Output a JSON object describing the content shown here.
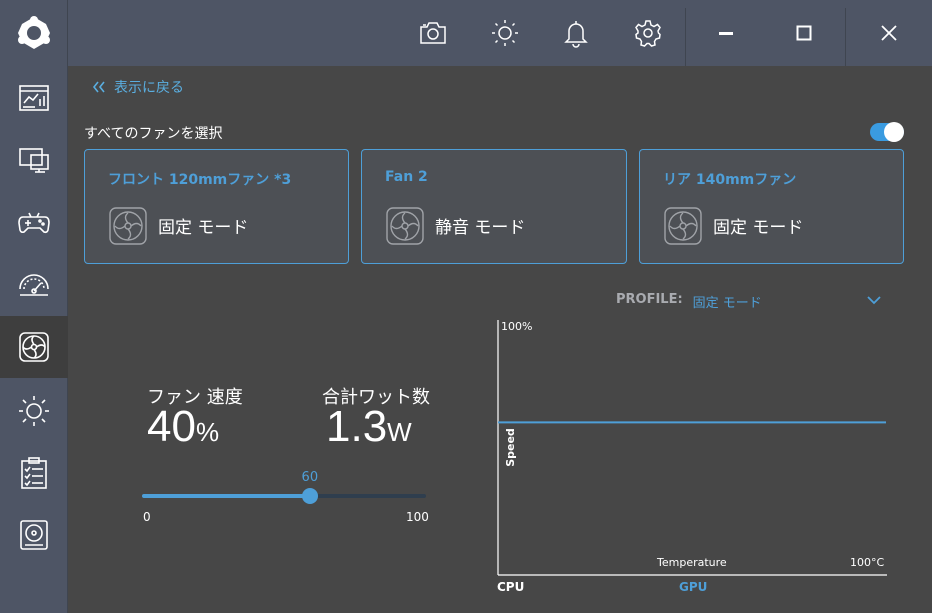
{
  "nav": {
    "items": [
      {
        "name": "dashboard-icon"
      },
      {
        "name": "monitor-icon"
      },
      {
        "name": "gamepad-icon"
      },
      {
        "name": "gauge-icon"
      },
      {
        "name": "fan-icon"
      },
      {
        "name": "brightness-icon"
      },
      {
        "name": "clipboard-icon"
      },
      {
        "name": "disk-icon"
      }
    ],
    "active_index": 4
  },
  "topbar": {
    "icons": [
      "camera-icon",
      "brightness-icon",
      "bell-icon",
      "gear-icon"
    ],
    "window_controls": [
      "minimize-icon",
      "maximize-icon",
      "close-icon"
    ]
  },
  "back_link": {
    "label": "表示に戻る"
  },
  "select_all": {
    "label": "すべてのファンを選択",
    "toggle_on": true
  },
  "fan_cards": [
    {
      "title": "フロント 120mmファン *3",
      "mode": "固定 モード"
    },
    {
      "title": "Fan 2",
      "mode": "静音 モード"
    },
    {
      "title": "リア 140mmファン",
      "mode": "固定 モード"
    }
  ],
  "profile": {
    "label": "PROFILE:",
    "value": "固定 モード"
  },
  "stats": {
    "fan_speed_label": "ファン 速度",
    "fan_speed_value": "40",
    "fan_speed_unit": "%",
    "watt_label": "合計ワット数",
    "watt_value": "1.3",
    "watt_unit": "W"
  },
  "slider": {
    "value": 60,
    "value_label": "60",
    "min": 0,
    "max": 100,
    "min_label": "0",
    "max_label": "100"
  },
  "chart": {
    "y_top_label": "100%",
    "y_axis_label": "Speed",
    "x_axis_label": "Temperature",
    "x_max_label": "100°C",
    "tabs": [
      "CPU",
      "GPU"
    ]
  },
  "chart_data": {
    "type": "line",
    "x": [
      0,
      100
    ],
    "series": [
      {
        "values": [
          60,
          60
        ]
      }
    ],
    "xlabel": "Temperature",
    "ylabel": "Speed",
    "xlim": [
      0,
      100
    ],
    "ylim": [
      0,
      100
    ]
  },
  "colors": {
    "accent": "#4e9fd8",
    "sidebar": "#4e5565",
    "background": "#474747"
  }
}
